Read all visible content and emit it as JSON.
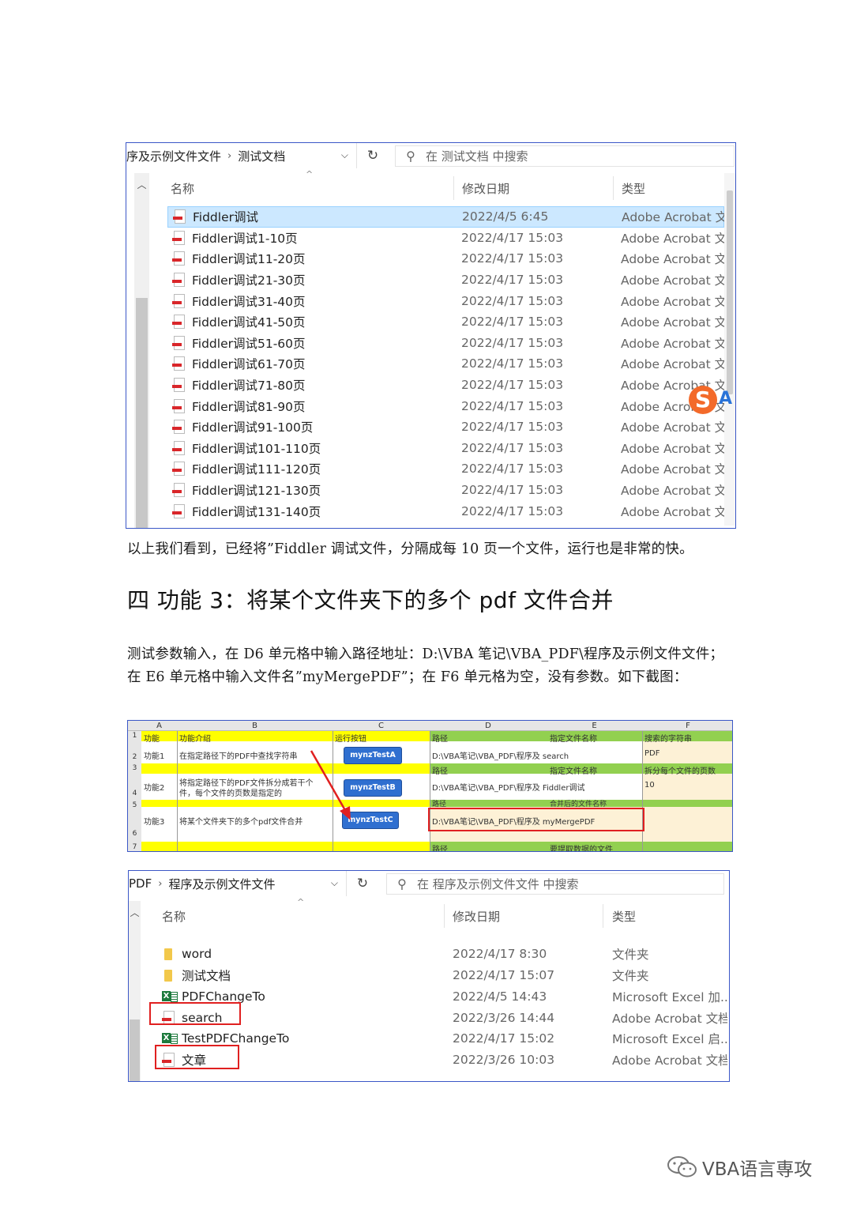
{
  "explorer1": {
    "breadcrumb": [
      "序及示例文件文件",
      "测试文档"
    ],
    "search_placeholder": "在 测试文档 中搜索",
    "columns": {
      "name": "名称",
      "date": "修改日期",
      "type": "类型"
    },
    "files": [
      {
        "name": "Fiddler调试",
        "date": "2022/4/5 6:45",
        "type": "Adobe Acrobat 文"
      },
      {
        "name": "Fiddler调试1-10页",
        "date": "2022/4/17 15:03",
        "type": "Adobe Acrobat 文"
      },
      {
        "name": "Fiddler调试11-20页",
        "date": "2022/4/17 15:03",
        "type": "Adobe Acrobat 文"
      },
      {
        "name": "Fiddler调试21-30页",
        "date": "2022/4/17 15:03",
        "type": "Adobe Acrobat 文"
      },
      {
        "name": "Fiddler调试31-40页",
        "date": "2022/4/17 15:03",
        "type": "Adobe Acrobat 文"
      },
      {
        "name": "Fiddler调试41-50页",
        "date": "2022/4/17 15:03",
        "type": "Adobe Acrobat 文"
      },
      {
        "name": "Fiddler调试51-60页",
        "date": "2022/4/17 15:03",
        "type": "Adobe Acrobat 文"
      },
      {
        "name": "Fiddler调试61-70页",
        "date": "2022/4/17 15:03",
        "type": "Adobe Acrobat 文"
      },
      {
        "name": "Fiddler调试71-80页",
        "date": "2022/4/17 15:03",
        "type": "Adobe Acrobat 文"
      },
      {
        "name": "Fiddler调试81-90页",
        "date": "2022/4/17 15:03",
        "type": "Adobe Acrobat 文"
      },
      {
        "name": "Fiddler调试91-100页",
        "date": "2022/4/17 15:03",
        "type": "Adobe Acrobat 文"
      },
      {
        "name": "Fiddler调试101-110页",
        "date": "2022/4/17 15:03",
        "type": "Adobe Acrobat 文"
      },
      {
        "name": "Fiddler调试111-120页",
        "date": "2022/4/17 15:03",
        "type": "Adobe Acrobat 文"
      },
      {
        "name": "Fiddler调试121-130页",
        "date": "2022/4/17 15:03",
        "type": "Adobe Acrobat 文"
      },
      {
        "name": "Fiddler调试131-140页",
        "date": "2022/4/17 15:03",
        "type": "Adobe Acrobat 文"
      }
    ],
    "ime_badge": "S",
    "ime_letter": "A"
  },
  "text": {
    "para1": "以上我们看到，已经将”Fiddler 调试文件，分隔成每 10 页一个文件，运行也是非常的快。",
    "heading": "四  功能 3：将某个文件夹下的多个 pdf 文件合并",
    "para2_line1": "测试参数输入，在 D6 单元格中输入路径地址：D:\\VBA 笔记\\VBA_PDF\\程序及示例文件文件；",
    "para2_line2": "在 E6 单元格中输入文件名”myMergePDF”；在 F6 单元格为空，没有参数。如下截图："
  },
  "excel": {
    "col_headers": [
      "A",
      "B",
      "C",
      "D",
      "E",
      "F"
    ],
    "row_numbers": [
      "1",
      "2",
      "3",
      "4",
      "5",
      "6",
      "7"
    ],
    "row1": {
      "a": "功能",
      "b": "功能介绍",
      "c": "运行按钮",
      "d": "路径",
      "e": "指定文件名称",
      "f": "搜索的字符串"
    },
    "row2": {
      "a": "功能1",
      "b": "在指定路径下的PDF中查找字符串",
      "button": "mynzTestA",
      "d": "D:\\VBA笔记\\VBA_PDF\\程序及 search",
      "f": "PDF"
    },
    "row3": {
      "d": "路径",
      "e": "指定文件名称",
      "f": "拆分每个文件的页数"
    },
    "row4": {
      "a": "功能2",
      "b1": "将指定路径下的PDF文件拆分成若干个",
      "b2": "件，每个文件的页数是指定的",
      "button": "mynzTestB",
      "d": "D:\\VBA笔记\\VBA_PDF\\程序及 Fiddler调试",
      "f": "10"
    },
    "row5": {
      "d": "路径",
      "e": "合并后的文件名称"
    },
    "row6": {
      "a": "功能3",
      "b": "将某个文件夹下的多个pdf文件合并",
      "button": "mynzTestC",
      "d": "D:\\VBA笔记\\VBA_PDF\\程序及 myMergePDF"
    },
    "row7": {
      "d": "路径",
      "e": "要提取数据的文件"
    },
    "colors": {
      "yellow": "#ffff00",
      "green": "#92d050",
      "beige": "#fdf1d6",
      "button": "#2f6fd0",
      "highlight": "#e02020"
    }
  },
  "explorer2": {
    "breadcrumb": [
      "PDF",
      "程序及示例文件文件"
    ],
    "search_placeholder": "在 程序及示例文件文件 中搜索",
    "columns": {
      "name": "名称",
      "date": "修改日期",
      "type": "类型"
    },
    "files": [
      {
        "icon": "folder",
        "name": "word",
        "date": "2022/4/17 8:30",
        "type": "文件夹"
      },
      {
        "icon": "folder",
        "name": "测试文档",
        "date": "2022/4/17 15:07",
        "type": "文件夹"
      },
      {
        "icon": "excel",
        "name": "PDFChangeTo",
        "date": "2022/4/5 14:43",
        "type": "Microsoft Excel 加..."
      },
      {
        "icon": "pdf",
        "name": "search",
        "date": "2022/3/26 14:44",
        "type": "Adobe Acrobat 文档"
      },
      {
        "icon": "excel",
        "name": "TestPDFChangeTo",
        "date": "2022/4/17 15:02",
        "type": "Microsoft Excel 启..."
      },
      {
        "icon": "pdf",
        "name": "文章",
        "date": "2022/3/26 10:03",
        "type": "Adobe Acrobat 文档"
      }
    ]
  },
  "watermark": "VBA语言専攻"
}
